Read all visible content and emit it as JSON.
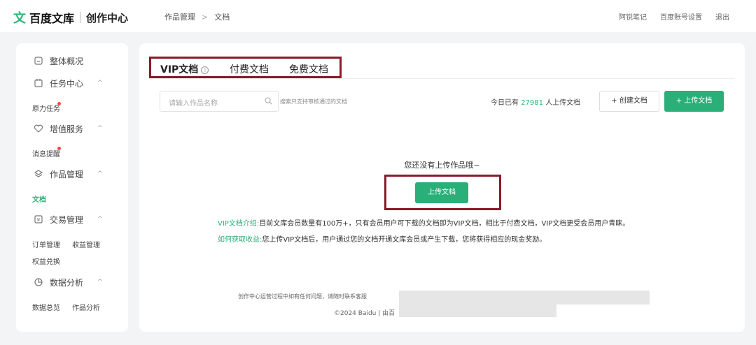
{
  "header": {
    "brand_icon": "文",
    "brand_name": "百度文库",
    "brand_sub": "创作中心",
    "breadcrumb": [
      "作品管理",
      "文档"
    ],
    "breadcrumb_sep": ">",
    "links": [
      "阿锐笔记",
      "百度账号设置",
      "退出"
    ]
  },
  "sidebar": {
    "overview": "整体概况",
    "task_center": "任务中心",
    "task_sub": "原力任务",
    "value_service": "增值服务",
    "value_sub": "消息提醒",
    "works": "作品管理",
    "works_sub": "文档",
    "trade": "交易管理",
    "trade_subs": [
      "订单管理",
      "收益管理",
      "权益兑换"
    ],
    "analytics": "数据分析",
    "analytics_subs": [
      "数据总览",
      "作品分析"
    ],
    "chevron": "^"
  },
  "tabs": {
    "vip": "VIP文档",
    "paid": "付费文档",
    "free": "免费文档",
    "info_glyph": "!"
  },
  "toolbar": {
    "search_placeholder": "请输入作品名称",
    "search_hint": "搜索只支持审核通过的文档",
    "today_prefix": "今日已有",
    "today_count": "27981",
    "today_suffix": "人上传文档",
    "create_button": "+ 创建文档",
    "upload_button": "+ 上传文档"
  },
  "empty": {
    "message": "您还没有上传作品哦~",
    "upload_button": "上传文档"
  },
  "intro": {
    "vip_key": "VIP文档介绍:",
    "vip_text": "目前文库会员数量有100万+，只有会员用户可下载的文档即为VIP文档，相比于付费文档，VIP文档更受会员用户青睐。",
    "income_key": "如何获取收益:",
    "income_text": "您上传VIP文档后，用户通过您的文档开通文库会员或产生下载，您将获得相应的现金奖励。"
  },
  "footer": {
    "line1": "创作中心运营过程中如有任何问题，请随时联系客服",
    "line2": "©2024 Baidu  |  由百"
  },
  "colors": {
    "accent": "#2aaf79",
    "highlight_border": "#8b1a2b",
    "notification_dot": "#ff4444"
  },
  "icons": {
    "overview": "home-icon",
    "task": "calendar-icon",
    "value": "heart-icon",
    "works": "layers-icon",
    "trade": "wallet-icon",
    "analytics": "pie-chart-icon",
    "search": "search-icon",
    "info": "info-icon"
  }
}
